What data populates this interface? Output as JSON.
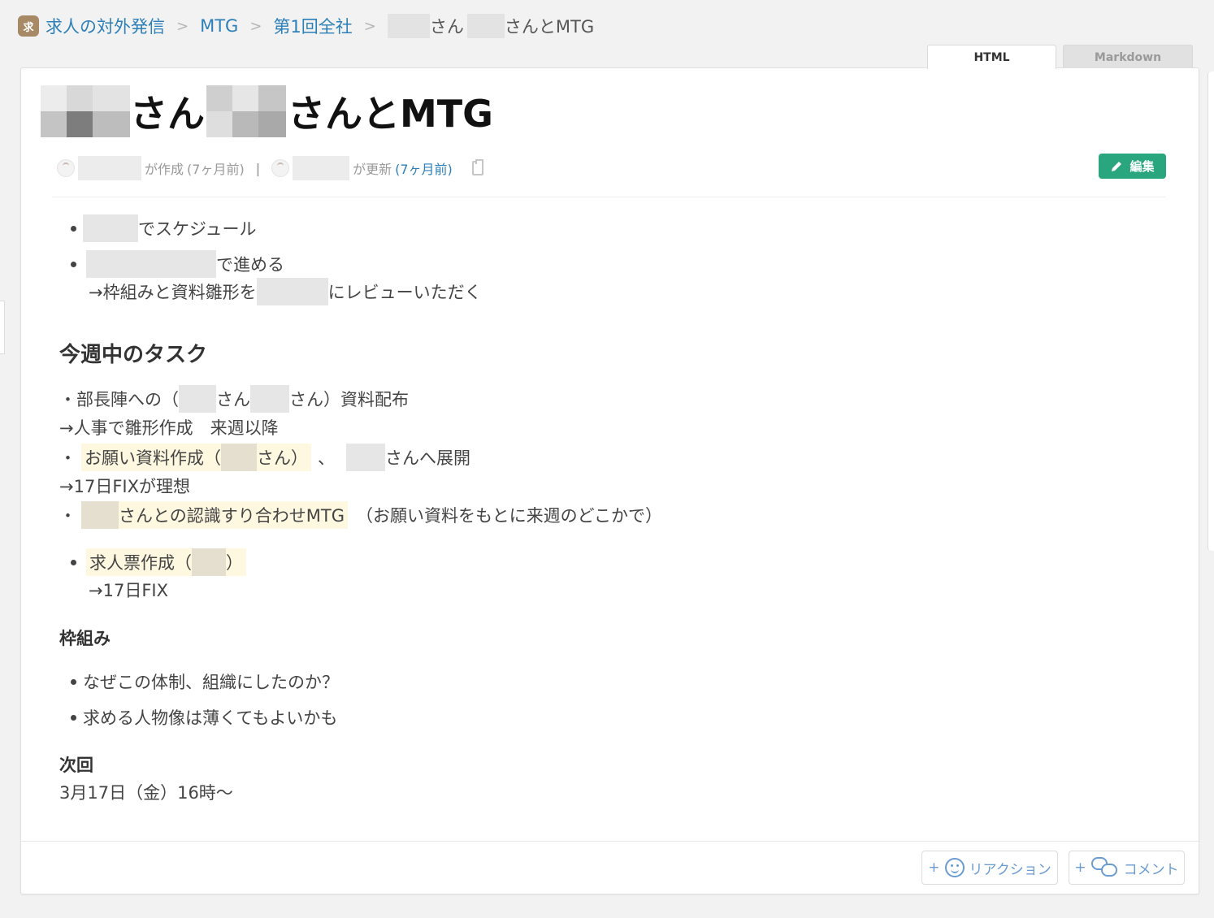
{
  "breadcrumb": {
    "icon_char": "求",
    "items": [
      "求人の対外発信",
      "MTG",
      "第1回全社"
    ],
    "current_parts": [
      "さん",
      "さんとMTG"
    ],
    "separator": ">"
  },
  "tabs": {
    "html": "HTML",
    "markdown": "Markdown"
  },
  "page": {
    "title_parts": [
      "さん",
      "さんとMTG"
    ],
    "meta": {
      "created_suffix": "が作成",
      "created_ago": "(7ヶ月前)",
      "divider": "|",
      "updated_suffix": "が更新",
      "updated_ago": "(7ヶ月前)"
    },
    "edit_label": "編集"
  },
  "content": {
    "bullets_top": {
      "item1_tail": "でスケジュール",
      "item2_tail": "で進める",
      "item2_sub_head": "→枠組みと資料雛形を",
      "item2_sub_tail": "にレビューいただく"
    },
    "section_tasks": {
      "heading": "今週中のタスク",
      "line1_head": "・部長陣への（",
      "line1_mid": "さん",
      "line1_tail": "さん）資料配布",
      "line2": "→人事で雛形作成　来週以降",
      "line3_dot": "・",
      "line3_hl_head": "お願い資料作成（",
      "line3_hl_tail": "さん）",
      "line3_sep": "、",
      "line3_tail": "さんへ展開",
      "line4": "→17日FIXが理想",
      "line5_dot": "・",
      "line5_hl": "さんとの認識すり合わせMTG",
      "line5_tail": "（お願い資料をもとに来週のどこかで）",
      "bullet_hl_head": "求人票作成（",
      "bullet_hl_tail": "）",
      "bullet_sub": "→17日FIX"
    },
    "section_frame": {
      "heading": "枠組み",
      "items": [
        "なぜこの体制、組織にしたのか？",
        "求める人物像は薄くてもよいかも"
      ]
    },
    "section_next": {
      "heading": "次回",
      "text": "3月17日（金）16時～"
    }
  },
  "footer": {
    "reaction_label": "リアクション",
    "comment_label": "コメント",
    "plus": "+"
  },
  "colors": {
    "link": "#2c7fb8",
    "edit_button": "#2aa67f",
    "highlight": "#fff8e1",
    "footer_accent": "#6a9bd1"
  }
}
